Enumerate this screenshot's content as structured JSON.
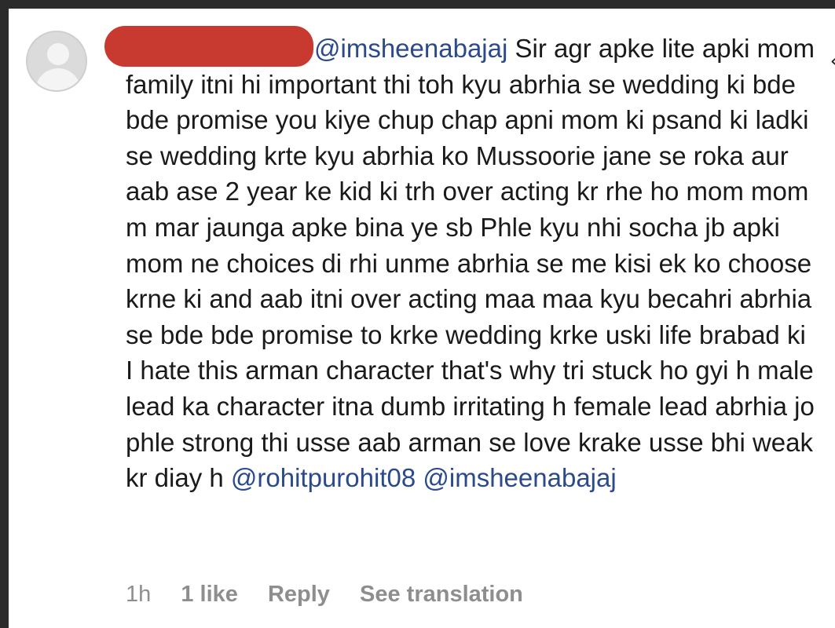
{
  "comment": {
    "mention_start": "@imsheenabajaj",
    "text": "Sir agr apke lite apki mom family itni hi important thi toh kyu abrhia se wedding ki bde bde promise you kiye chup chap apni mom ki psand ki ladki se wedding krte kyu abrhia ko Mussoorie jane se roka aur aab ase 2 year ke kid ki trh over acting kr rhe ho mom mom m mar jaunga apke bina ye sb Phle kyu nhi socha jb apki mom ne choices di rhi unme abrhia se me kisi ek ko choose krne ki and aab itni over acting maa maa kyu becahri abrhia se bde bde promise to krke wedding krke uski life brabad ki I hate this arman character that's why tri stuck ho gyi h male lead ka character itna dumb irritating h female lead abrhia jo phle strong thi usse aab arman se love krake usse bhi weak kr diay h",
    "mention_end_1": "@rohitpurohit08",
    "mention_end_2": "@imsheenabajaj"
  },
  "meta": {
    "time": "1h",
    "likes": "1 like",
    "reply": "Reply",
    "translate": "See translation"
  },
  "colors": {
    "mention": "#2a4a8c",
    "redaction": "#c83a2f",
    "meta": "#8e8e8e"
  }
}
